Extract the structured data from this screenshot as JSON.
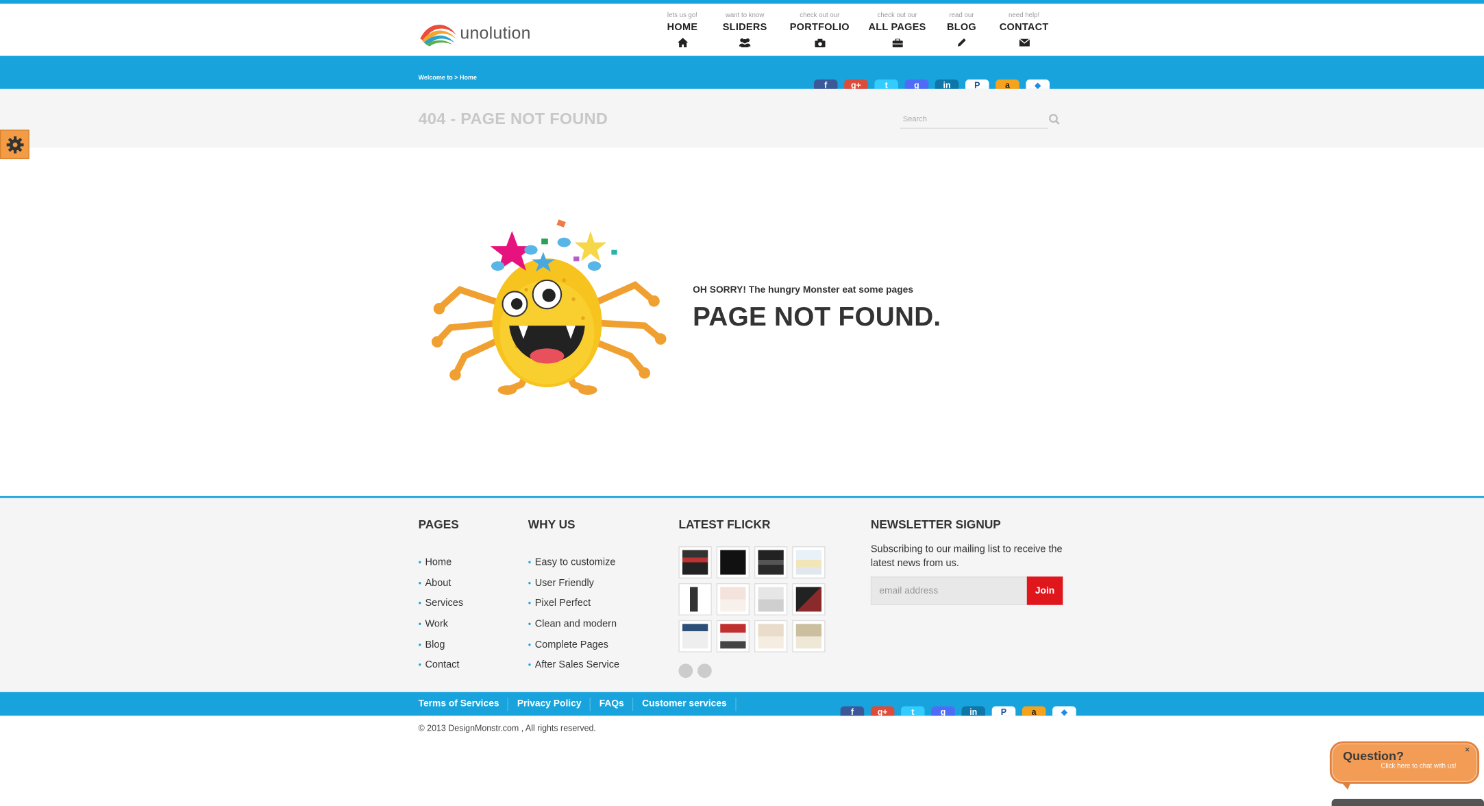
{
  "header": {
    "logo_text": "unolution",
    "nav": [
      {
        "small": "lets us go!",
        "label": "HOME",
        "icon": "home-icon"
      },
      {
        "small": "want to know",
        "label": "SLIDERS",
        "icon": "users-icon"
      },
      {
        "small": "check out our",
        "label": "PORTFOLIO",
        "icon": "camera-icon"
      },
      {
        "small": "check out our",
        "label": "ALL PAGES",
        "icon": "briefcase-icon"
      },
      {
        "small": "read our",
        "label": "BLOG",
        "icon": "pencil-icon"
      },
      {
        "small": "need help!",
        "label": "CONTACT",
        "icon": "envelope-icon"
      }
    ]
  },
  "breadcrumb": "Welcome to > Home",
  "social_icons": [
    {
      "name": "facebook-icon",
      "glyph": "f",
      "color": "#3b5998"
    },
    {
      "name": "google-plus-icon",
      "glyph": "g+",
      "color": "#dd4b39"
    },
    {
      "name": "twitter-icon",
      "glyph": "t",
      "color": "#33ccff"
    },
    {
      "name": "google-icon",
      "glyph": "g",
      "color": "#4e6cf7"
    },
    {
      "name": "linkedin-icon",
      "glyph": "in",
      "color": "#0e76a8"
    },
    {
      "name": "paypal-icon",
      "glyph": "P",
      "color": "#1b4e93"
    },
    {
      "name": "amazon-icon",
      "glyph": "a",
      "color": "#f7a21b"
    },
    {
      "name": "dropbox-icon",
      "glyph": "◆",
      "color": "#1f8ce6"
    }
  ],
  "page_title": "404 - PAGE NOT FOUND",
  "search": {
    "placeholder": "Search"
  },
  "error": {
    "subtitle": "OH SORRY! The hungry Monster eat some pages",
    "title": "PAGE NOT FOUND."
  },
  "footer": {
    "pages": {
      "heading": "PAGES",
      "items": [
        "Home",
        "About",
        "Services",
        "Work",
        "Blog",
        "Contact"
      ]
    },
    "why_us": {
      "heading": "WHY US",
      "items": [
        "Easy to customize",
        "User Friendly",
        "Pixel Perfect",
        "Clean and modern",
        "Complete Pages",
        "After Sales Service"
      ]
    },
    "flickr": {
      "heading": "LATEST FLICKR"
    },
    "newsletter": {
      "heading": "NEWSLETTER SIGNUP",
      "text": "Subscribing to our mailing list to receive the latest news from us.",
      "placeholder": "email address",
      "button": "Join"
    }
  },
  "bottom_links": [
    "Terms of Services",
    "Privacy Policy",
    "FAQs",
    "Customer services"
  ],
  "copyright": "© 2013 DesignMonstr.com , All rights reserved.",
  "chat": {
    "title": "Question?",
    "subtitle": "Click here to chat with us!",
    "close": "×"
  },
  "colors": {
    "accent": "#18a3dc",
    "join_button": "#e0161d",
    "chat": "#f39c55"
  }
}
